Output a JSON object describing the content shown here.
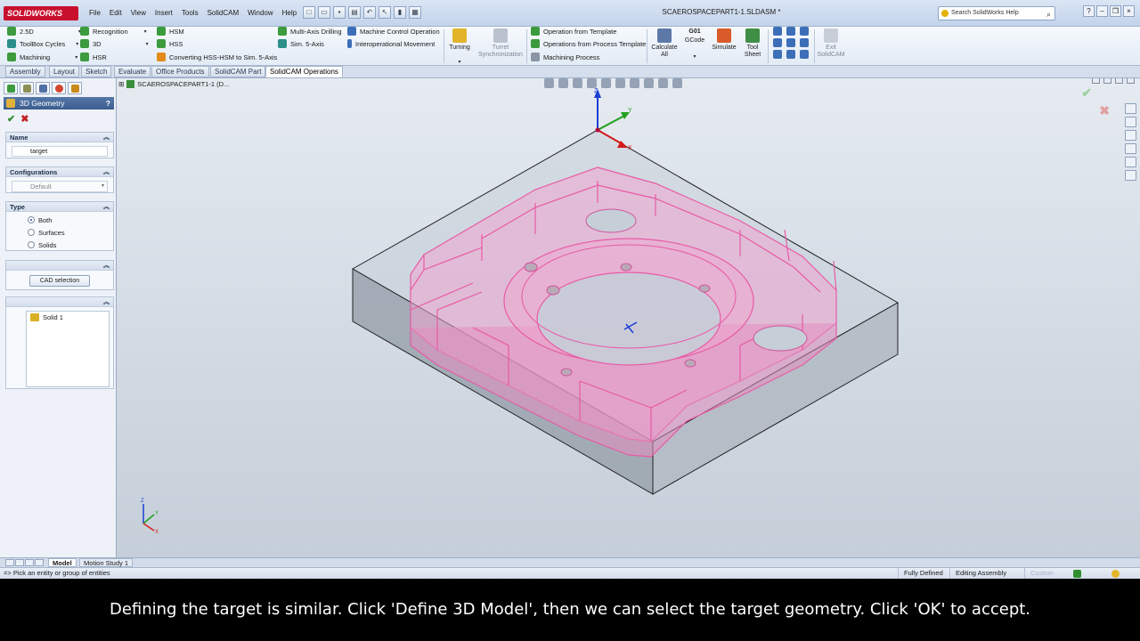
{
  "app": {
    "logo": "SOLIDWORKS",
    "doc_title": "SCAEROSPACEPART1-1.SLDASM *",
    "help_search_placeholder": "Search SolidWorks Help",
    "menu": [
      "File",
      "Edit",
      "View",
      "Insert",
      "Tools",
      "SolidCAM",
      "Window",
      "Help"
    ]
  },
  "ribbon": {
    "col1": [
      "2.5D",
      "ToolBox Cycles",
      "Machining"
    ],
    "col2": [
      "Recognition",
      "3D",
      "HSR"
    ],
    "col3": [
      "HSM",
      "HSS"
    ],
    "converting": "Converting HSS-HSM to Sim. 5-Axis",
    "col4": [
      "Multi-Axis Drilling",
      "Sim. 5-Axis"
    ],
    "col5": [
      "Machine Control Operation",
      "Interoperational Movement"
    ],
    "turning": "Turning",
    "turret_sync": [
      "Turret",
      "Synchronization"
    ],
    "col6": [
      "Operation from Template",
      "Operations from Process Template",
      "Machining Process"
    ],
    "calculate_all": [
      "Calculate",
      "All"
    ],
    "gcode": [
      "G01",
      "GCode"
    ],
    "simulate": "Simulate",
    "tool_sheet": [
      "Tool",
      "Sheet"
    ],
    "exit_solidcam": [
      "Exit",
      "SolidCAM"
    ]
  },
  "tabs": [
    "Assembly",
    "Layout",
    "Sketch",
    "Evaluate",
    "Office Products",
    "SolidCAM Part",
    "SolidCAM Operations"
  ],
  "panel": {
    "title": "3D Geometry",
    "help": "?",
    "name_section": "Name",
    "name_value": "target",
    "config_section": "Configurations",
    "config_value": "Default",
    "type_section": "Type",
    "type_options": [
      "Both",
      "Surfaces",
      "Solids"
    ],
    "type_selected": "Both",
    "cad_button": "CAD selection",
    "list_items": [
      "Solid 1"
    ]
  },
  "viewport": {
    "tree_root": "SCAEROSPACEPART1-1 (D..."
  },
  "bottom_tabs": [
    "Model",
    "Motion Study 1"
  ],
  "status": {
    "prompt": "=> Pick an entity or group of entities",
    "fully_defined": "Fully Defined",
    "editing": "Editing Assembly",
    "custom": "Custom"
  },
  "caption": "Defining the target is similar. Click 'Define 3D Model', then we can select the target geometry. Click 'OK' to accept."
}
